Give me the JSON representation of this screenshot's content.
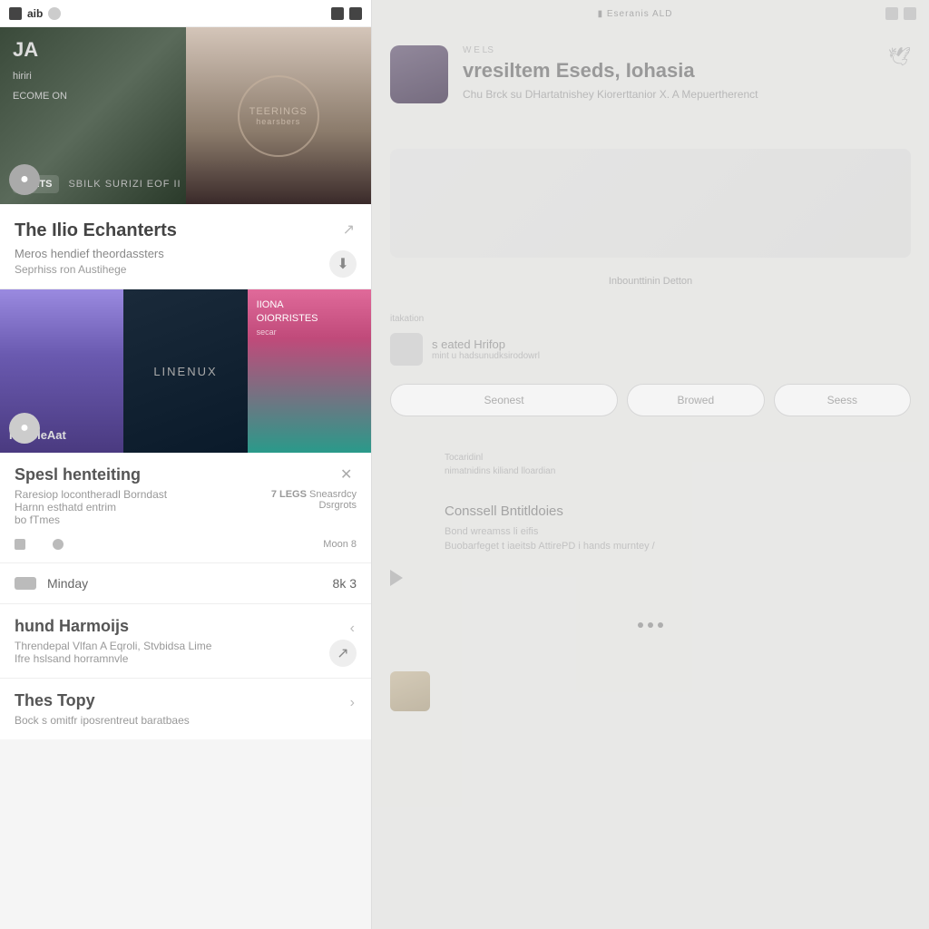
{
  "topbar": {
    "app_label": "aib",
    "right_status": "■"
  },
  "hero": {
    "tag": "JA",
    "line1": "hiriri",
    "line2": "ECOME ON",
    "badge": "FEETS",
    "sub": "SBILK SURIZI EOF II",
    "stamp_top": "TEERINGS",
    "stamp_bottom": "hearsbers"
  },
  "card1": {
    "title": "The Ilio Echanterts",
    "line": "Meros hendief theordassters",
    "meta": "Seprhiss ron Austihege"
  },
  "thumbs": {
    "t1_label": "RescleAat",
    "t2_label": "LINENUX",
    "t3_line1": "IIONA",
    "t3_line2": "OIORRISTES",
    "t3_line3": "secar"
  },
  "section2": {
    "title": "Spesl henteiting",
    "line1": "Raresiop locontheradl Borndast",
    "line2": "Harnn esthatd entrim",
    "line3": "bo fTmes",
    "meta1_label": "7 LEGS",
    "meta1_val": "Sneasrdcy",
    "meta2_val": "Dsrgrots",
    "meta3_val": "Moon 8"
  },
  "mini": {
    "label": "Minday",
    "value": "8k 3"
  },
  "section3": {
    "title": "hund Harmoijs",
    "line1": "Threndepal Vlfan A Eqroli, Stvbidsa Lime",
    "line2": "Ifre hslsand horramnvle"
  },
  "section4": {
    "title": "Thes Topy",
    "line": "Bock s omitfr iposrentreut baratbaes"
  },
  "right": {
    "top_center": "▮ Eseranis ALD",
    "faint_top": "W E LS",
    "title": "vresiltem Eseds, Iohasia",
    "sub": "Chu Brck su DHartatnishey   Kiorerttanior X. A Mepuertherenct",
    "caption": "Inbounttinin Detton",
    "tag_label": "itakation",
    "chip_label": "s eated Hrifop",
    "chip_sub": "mint u hadsunudksirodowrl",
    "pill1": "Seonest",
    "pill2": "Browed",
    "pill3": "Seess",
    "sec_over": "Tocaridinl",
    "sec_line": "nimatnidins kiliand lloardian",
    "sec_title": "Conssell Bntitldoies",
    "sec_sub": "Bond wreamss li eifis",
    "sec_desc": "Buobarfeget  t iaeitsb AttirePD i hands murntey /"
  }
}
